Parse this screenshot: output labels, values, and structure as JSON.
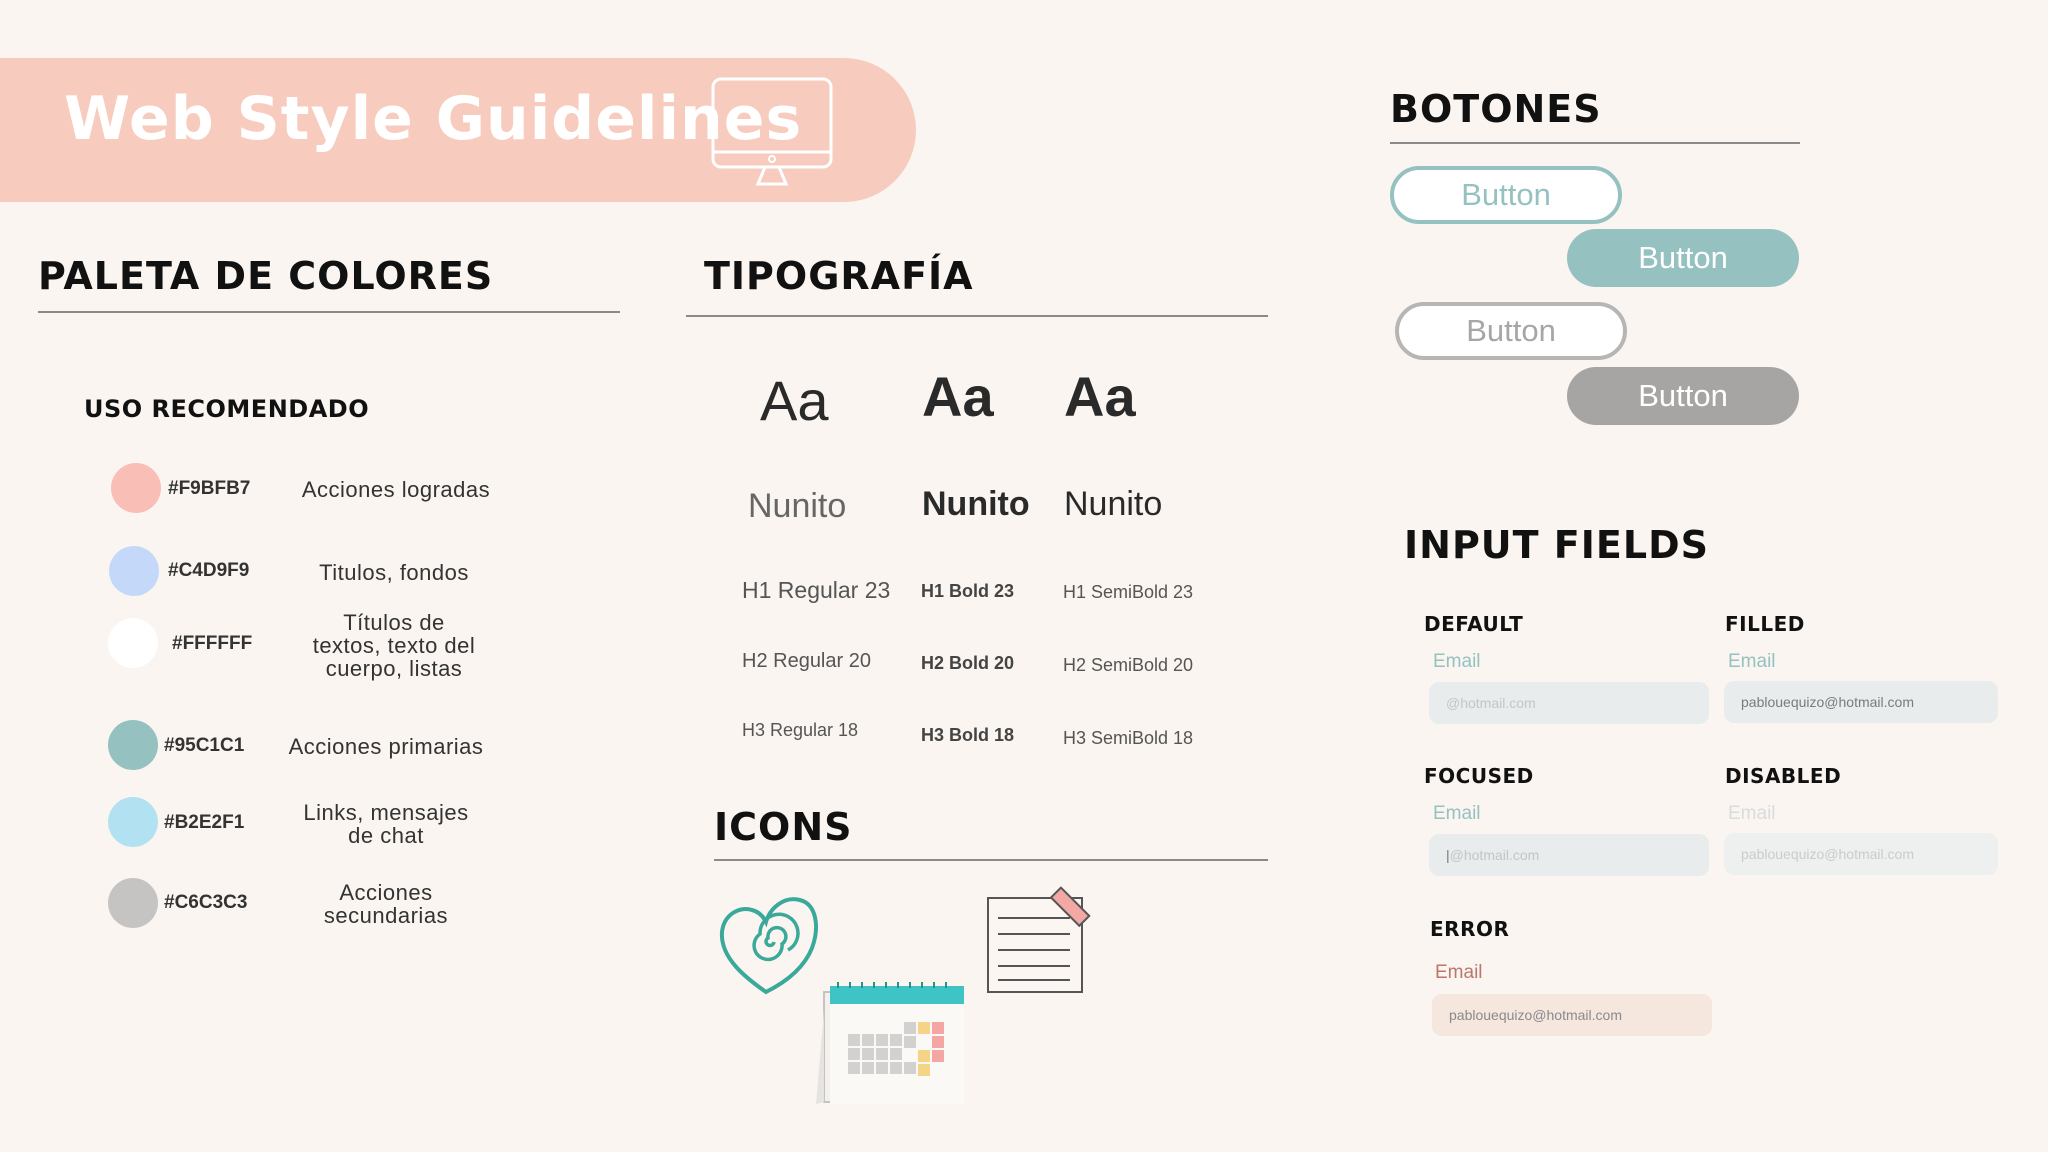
{
  "header": {
    "title": "Web Style Guidelines"
  },
  "palette": {
    "title": "PALETA DE COLORES",
    "subtitle": "USO RECOMENDADO",
    "colors": [
      {
        "hex": "#F9BFB7",
        "desc": "Acciones logradas"
      },
      {
        "hex": "#C4D9F9",
        "desc": "Titulos, fondos"
      },
      {
        "hex": "#FFFFFF",
        "desc_lines": [
          "Títulos de",
          "textos, texto del",
          "cuerpo, listas"
        ]
      },
      {
        "hex": "#95C1C1",
        "desc": "Acciones primarias"
      },
      {
        "hex": "#B2E2F1",
        "desc_lines": [
          "Links, mensajes",
          "de chat"
        ]
      },
      {
        "hex": "#C6C3C3",
        "desc_lines": [
          "Acciones",
          "secundarias"
        ]
      }
    ]
  },
  "typography": {
    "title": "TIPOGRAFÍA",
    "sample": "Aa",
    "font_name": "Nunito",
    "regular": [
      "H1 Regular 23",
      "H2 Regular 20",
      "H3 Regular 18"
    ],
    "bold": [
      "H1 Bold 23",
      "H2 Bold 20",
      "H3 Bold 18"
    ],
    "semibold": [
      "H1 SemiBold 23",
      "H2 SemiBold 20",
      "H3 SemiBold 18"
    ]
  },
  "icons": {
    "title": "ICONS",
    "items": [
      "heart-spiral-icon",
      "calendar-icon",
      "notepad-icon"
    ]
  },
  "buttons": {
    "title": "BOTONES",
    "labels": [
      "Button",
      "Button",
      "Button",
      "Button"
    ],
    "colors": {
      "primary": "#95C1C1",
      "secondary": "#A7A4A4"
    }
  },
  "inputs": {
    "title": "INPUT FIELDS",
    "default": {
      "state": "DEFAULT",
      "label": "Email",
      "placeholder": "@hotmail.com"
    },
    "filled": {
      "state": "FILLED",
      "label": "Email",
      "value": "pablouequizo@hotmail.com"
    },
    "focused": {
      "state": "FOCUSED",
      "label": "Email",
      "placeholder": "@hotmail.com"
    },
    "disabled": {
      "state": "DISABLED",
      "label": "Email",
      "value": "pablouequizo@hotmail.com"
    },
    "error": {
      "state": "ERROR",
      "label": "Email",
      "value": "pablouequizo@hotmail.com"
    }
  }
}
